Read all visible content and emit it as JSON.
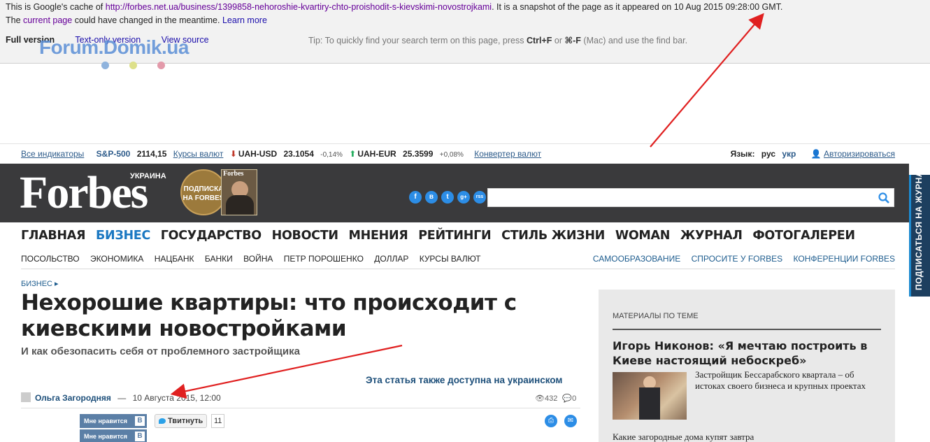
{
  "cache": {
    "prefix": "This is Google's cache of",
    "url": "http://forbes.net.ua/business/1399858-nehoroshie-kvartiry-chto-proishodit-s-kievskimi-novostrojkami",
    "snapshot": ". It is a snapshot of the page as it appeared on 10 Aug 2015 09:28:00 GMT.",
    "line2_the": "The",
    "current_page": "current page",
    "line2_rest": "could have changed in the meantime.",
    "learn_more": "Learn more",
    "full_version": "Full version",
    "text_only": "Text-only version",
    "view_source": "View source",
    "tip_prefix": "Tip: To quickly find your search term on this page, press",
    "tip_key1": "Ctrl+F",
    "tip_or": "or",
    "tip_key2": "⌘-F",
    "tip_suffix": "(Mac) and use the find bar."
  },
  "watermark": "Forum.Domik.ua",
  "indicators": {
    "all": "Все индикаторы",
    "sp_label": "S&P-500",
    "sp_value": "2114,15",
    "rates": "Курсы валют",
    "usd_label": "UAH-USD",
    "usd_value": "23.1054",
    "usd_change": "-0,14%",
    "eur_label": "UAH-EUR",
    "eur_value": "25.3599",
    "eur_change": "+0,08%",
    "converter": "Конвертер валют",
    "lang_label": "Язык:",
    "lang_ru": "рус",
    "lang_ua": "укр",
    "login": "Авторизироваться"
  },
  "header": {
    "logo": "Forbes",
    "edition": "УКРАИНА",
    "subscribe": "ПОДПИСКА НА FORBES",
    "mag_title": "Forbes",
    "social": [
      "f",
      "в",
      "t",
      "g+",
      "rss"
    ]
  },
  "side_tab": "ПОДПИСАТЬСЯ НА ЖУРНАЛ",
  "nav": [
    "ГЛАВНАЯ",
    "БИЗНЕС",
    "ГОСУДАРСТВО",
    "НОВОСТИ",
    "МНЕНИЯ",
    "РЕЙТИНГИ",
    "СТИЛЬ ЖИЗНИ",
    "WOMAN",
    "ЖУРНАЛ",
    "ФОТОГАЛЕРЕИ"
  ],
  "subnav_left": [
    "ПОСОЛЬСТВО",
    "ЭКОНОМИКА",
    "НАЦБАНК",
    "БАНКИ",
    "ВОЙНА",
    "ПЕТР ПОРОШЕНКО",
    "ДОЛЛАР",
    "КУРСЫ ВАЛЮТ"
  ],
  "subnav_right": [
    "САМООБРАЗОВАНИЕ",
    "СПРОСИТЕ У FORBES",
    "КОНФЕРЕНЦИИ FORBES"
  ],
  "article": {
    "breadcrumb": "БИЗНЕС ▸",
    "title": "Нехорошие квартиры: что происходит с киевскими новостройками",
    "subtitle": "И как обезопасить себя от проблемного застройщика",
    "ukrainian_link": "Эта статья также доступна на украинском",
    "author": "Ольга Загородняя",
    "dash": "—",
    "date": "10 Августа 2015, 12:00",
    "views": "432",
    "comments": "0",
    "like_label": "Мне нравится",
    "vk_letter": "B",
    "tweet_label": "Твитнуть",
    "tweet_count": "11"
  },
  "aside": {
    "heading": "МАТЕРИАЛЫ ПО ТЕМЕ",
    "item1_title": "Игорь Никонов: «Я мечтаю построить в Киеве настоящий небоскреб»",
    "item1_desc": "Застройщик Бессарабского квартала – об истоках своего бизнеса и крупных проектах",
    "item2_title": "Какие загородные дома купят завтра"
  },
  "colors": {
    "accent": "#1b78c2",
    "header_bg": "#3a3a3c",
    "arrow": "#e02020",
    "down": "#c0392b",
    "up": "#27ae60"
  }
}
